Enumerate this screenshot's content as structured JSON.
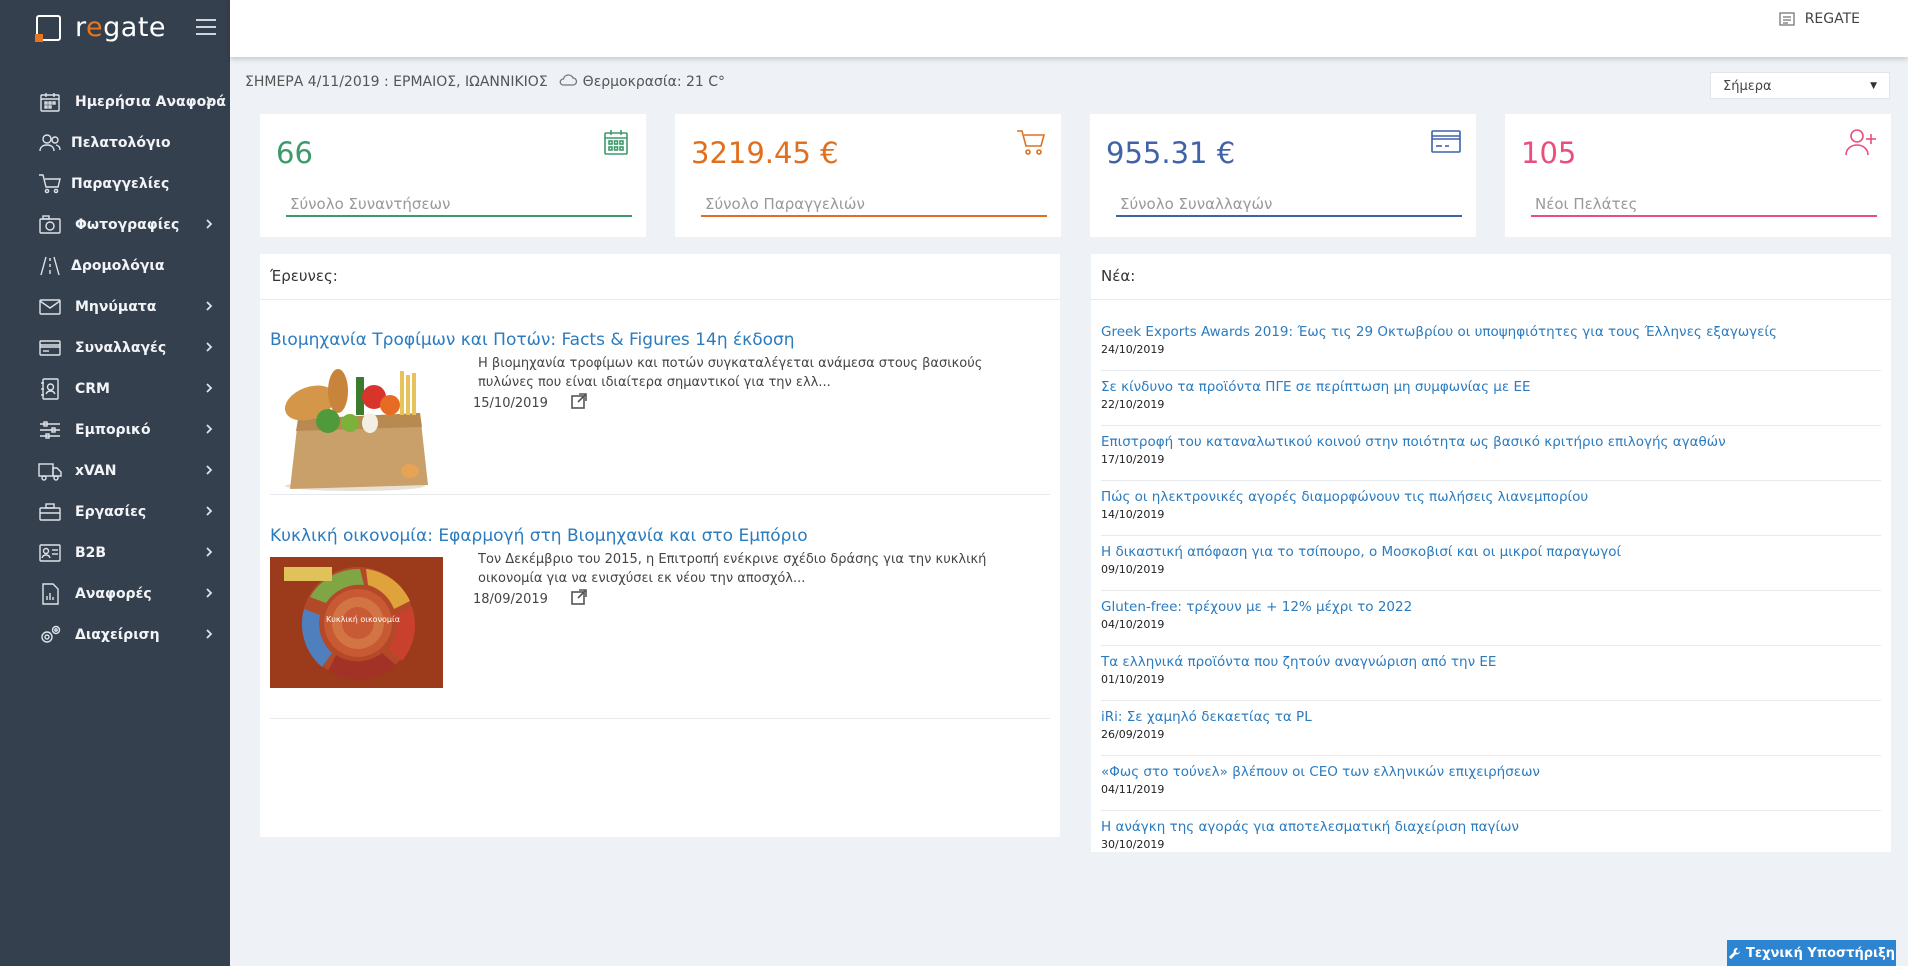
{
  "brand": {
    "name_prefix": "r",
    "name_o": "e",
    "name_suffix": "gate"
  },
  "sidebar": {
    "items": [
      {
        "label": "Ημερήσια Αναφορά",
        "icon": "calendar-icon",
        "chevron": true
      },
      {
        "label": "Πελατολόγιο",
        "icon": "users-icon",
        "chevron": false
      },
      {
        "label": "Παραγγελίες",
        "icon": "cart-icon",
        "chevron": false
      },
      {
        "label": "Φωτογραφίες",
        "icon": "camera-icon",
        "chevron": true
      },
      {
        "label": "Δρομολόγια",
        "icon": "road-icon",
        "chevron": false
      },
      {
        "label": "Μηνύματα",
        "icon": "envelope-icon",
        "chevron": true
      },
      {
        "label": "Συναλλαγές",
        "icon": "credit-card-icon",
        "chevron": true
      },
      {
        "label": "CRM",
        "icon": "contact-book-icon",
        "chevron": true
      },
      {
        "label": "Εμπορικό",
        "icon": "sliders-icon",
        "chevron": true
      },
      {
        "label": "xVAN",
        "icon": "truck-icon",
        "chevron": true
      },
      {
        "label": "Εργασίες",
        "icon": "toolbox-icon",
        "chevron": true
      },
      {
        "label": "B2B",
        "icon": "id-card-icon",
        "chevron": true
      },
      {
        "label": "Αναφορές",
        "icon": "report-icon",
        "chevron": true
      },
      {
        "label": "Διαχείριση",
        "icon": "gears-icon",
        "chevron": true
      }
    ]
  },
  "topbar": {
    "user_label": "REGATE"
  },
  "dateline": {
    "date_text": "ΣΗΜΕΡΑ 4/11/2019 : ΕΡΜΑΙΟΣ, ΙΩΑΝΝΙΚΙΟΣ",
    "weather_text": "Θερμοκρασία: 21 C°"
  },
  "period_select": {
    "value": "Σήμερα"
  },
  "stats": [
    {
      "value": "66",
      "label": "Σύνολο Συναντήσεων",
      "color": "#3d9a6b",
      "icon": "calendar-icon"
    },
    {
      "value": "3219.45 €",
      "label": "Σύνολο Παραγγελιών",
      "color": "#e0701f",
      "icon": "cart-icon"
    },
    {
      "value": "955.31 €",
      "label": "Σύνολο Συναλλαγών",
      "color": "#3f62a8",
      "icon": "credit-card-icon"
    },
    {
      "value": "105",
      "label": "Νέοι Πελάτες",
      "color": "#ea4e7c",
      "icon": "add-user-icon"
    }
  ],
  "research": {
    "heading": "Έρευνες:",
    "items": [
      {
        "title": "Βιομηχανία Τροφίμων και Ποτών: Facts & Figures 14η έκδοση",
        "desc": "Η βιομηχανία τροφίμων και ποτών συγκαταλέγεται ανάμεσα στους βασικούς πυλώνες που είναι ιδιαίτερα σημαντικοί για την ελλ...",
        "date": "15/10/2019"
      },
      {
        "title": "Κυκλική οικονομία: Εφαρμογή στη Βιομηχανία και στο Εμπόριο",
        "desc": "Τον Δεκέμβριο του 2015, η Επιτροπή ενέκρινε σχέδιο δράσης για την κυκλική οικονομία για να ενισχύσει εκ νέου την αποσχόλ...",
        "date": "18/09/2019",
        "image_text": "Κυκλική οικονομία"
      }
    ]
  },
  "news": {
    "heading": "Νέα:",
    "items": [
      {
        "title": "Greek Exports Awards 2019: Έως τις 29 Οκτωβρίου οι υποψηφιότητες για τους Έλληνες εξαγωγείς",
        "date": "24/10/2019"
      },
      {
        "title": "Σε κίνδυνο τα προϊόντα ΠΓΕ σε περίπτωση μη συμφωνίας με ΕΕ",
        "date": "22/10/2019"
      },
      {
        "title": "Επιστροφή του καταναλωτικού κοινού στην ποιότητα ως βασικό κριτήριο επιλογής αγαθών",
        "date": "17/10/2019"
      },
      {
        "title": "Πώς οι ηλεκτρονικές αγορές διαμορφώνουν τις πωλήσεις λιανεμπορίου",
        "date": "14/10/2019"
      },
      {
        "title": "Η δικαστική απόφαση για το τσίπουρο, ο Μοσκοβισί και οι μικροί παραγωγοί",
        "date": "09/10/2019"
      },
      {
        "title": "Gluten-free: τρέχουν με + 12% μέχρι το 2022",
        "date": "04/10/2019"
      },
      {
        "title": "Τα ελληνικά προϊόντα που ζητούν αναγνώριση από την ΕΕ",
        "date": "01/10/2019"
      },
      {
        "title": "iRi: Σε χαμηλό δεκαετίας τα PL",
        "date": "26/09/2019"
      },
      {
        "title": "«Φως στο τούνελ» βλέπουν οι CEO των ελληνικών επιχειρήσεων",
        "date": "04/11/2019"
      },
      {
        "title": "Η ανάγκη της αγοράς για αποτελεσματική διαχείριση παγίων",
        "date": "30/10/2019"
      }
    ]
  },
  "support": {
    "label": "Τεχνική Υποστήριξη"
  }
}
